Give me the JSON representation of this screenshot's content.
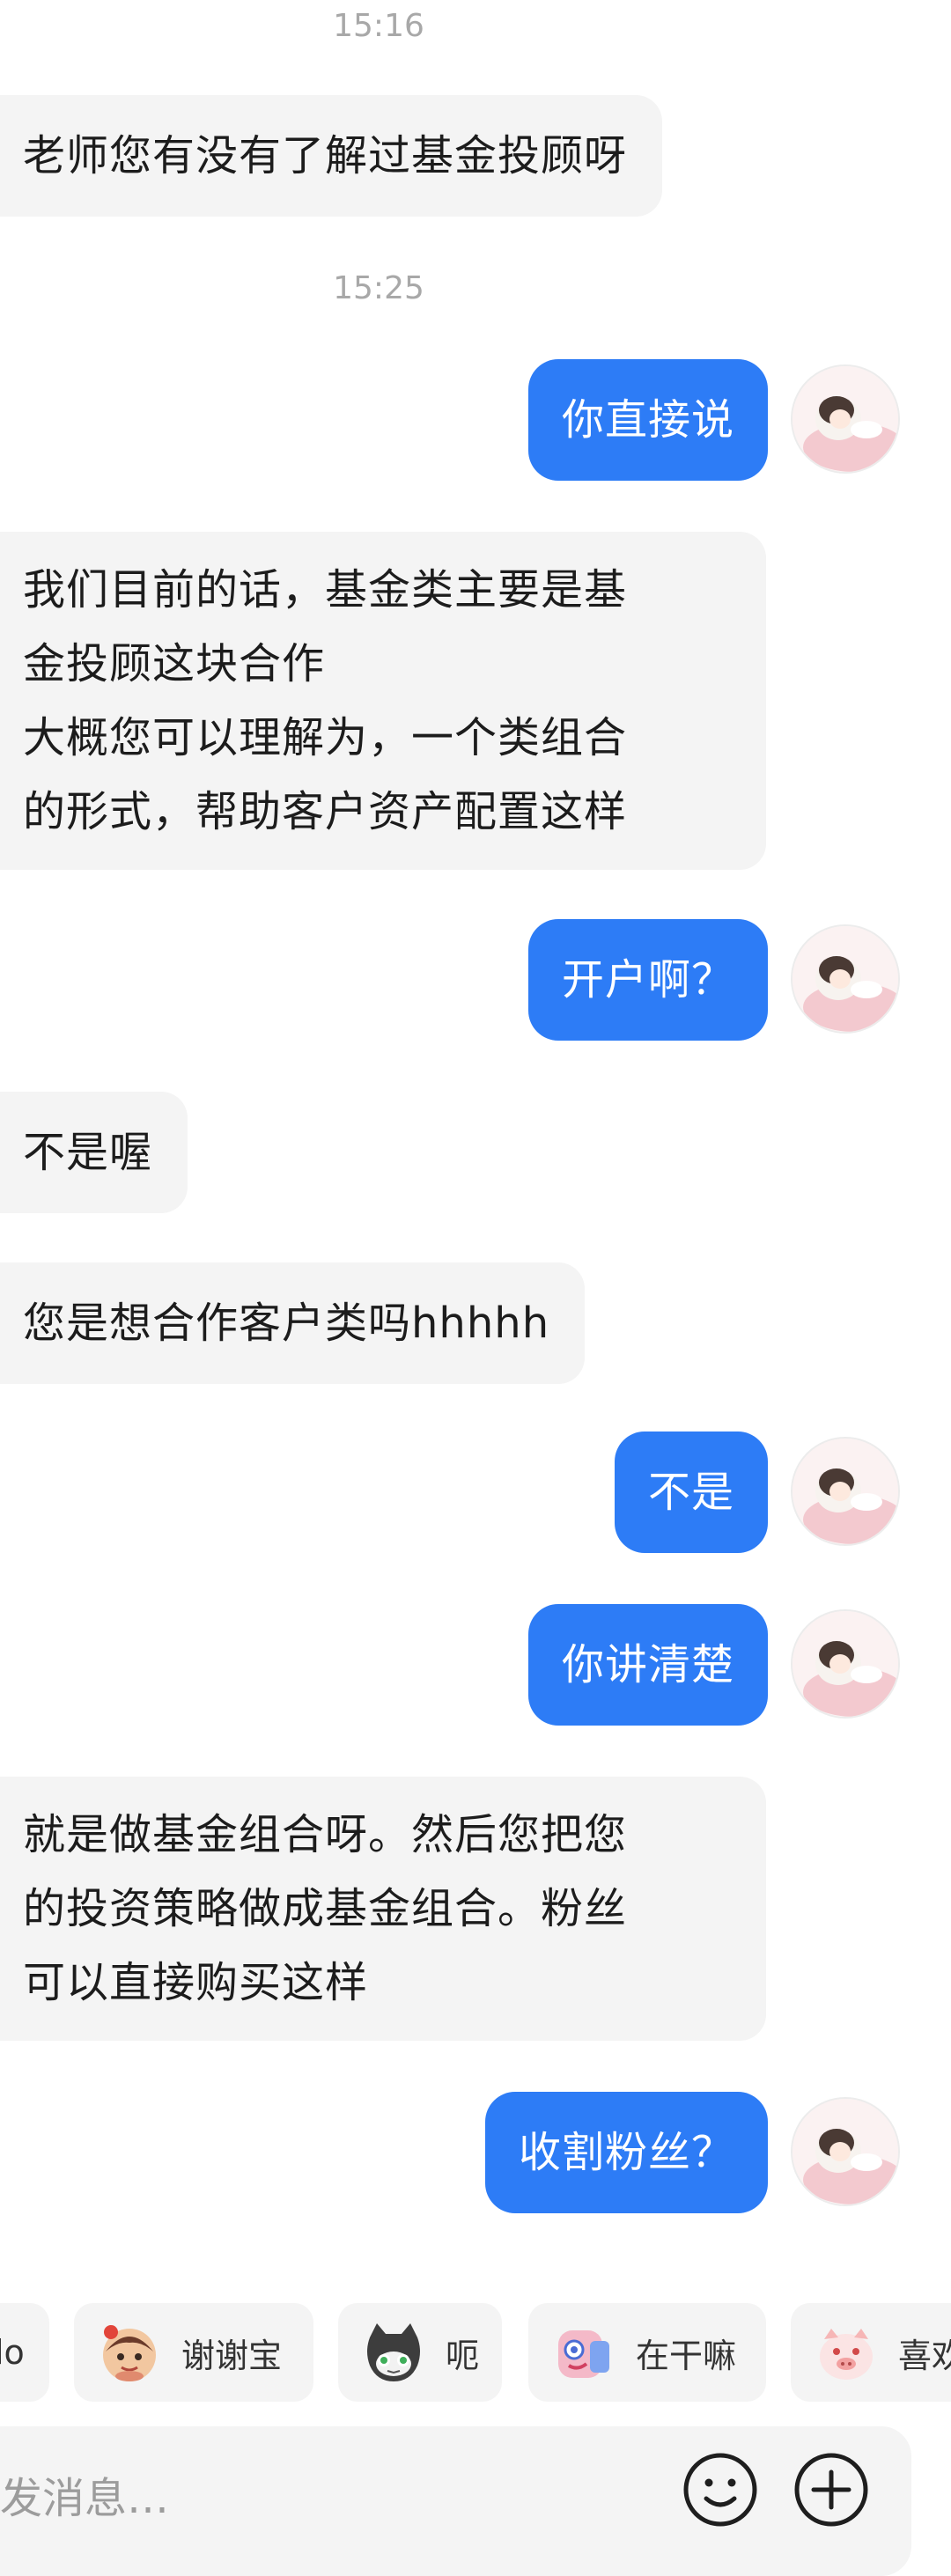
{
  "messages": {
    "t1": "15:16",
    "m1": "老师您有没有了解过基金投顾呀",
    "t2": "15:25",
    "m2": "你直接说",
    "m3": "我们目前的话，基金类主要是基\n金投顾这块合作\n大概您可以理解为，一个类组合\n的形式，帮助客户资产配置这样",
    "m4": "开户啊？",
    "m5": "不是喔",
    "m6": "您是想合作客户类吗hhhhh",
    "m7": "不是",
    "m8": "你讲清楚",
    "m9": "就是做基金组合呀。然后您把您\n的投资策略做成基金组合。粉丝\n可以直接购买这样",
    "m10": "收割粉丝？"
  },
  "quick_replies": [
    {
      "label": "lo",
      "icon": "partial-chip"
    },
    {
      "label": "谢谢宝",
      "icon": "thank-you-emoji-icon"
    },
    {
      "label": "呃",
      "icon": "cat-emoji-icon"
    },
    {
      "label": "在干嘛",
      "icon": "peek-emoji-icon"
    },
    {
      "label": "喜欢",
      "icon": "pig-emoji-icon"
    }
  ],
  "input": {
    "placeholder": "发消息…"
  },
  "icons": {
    "emoji_button": "smiley-icon",
    "plus_button": "plus-circle-icon"
  },
  "colors": {
    "outgoing_bubble": "#2d7cf6",
    "incoming_bubble": "#f4f4f4",
    "timestamp": "#a8a8a8"
  }
}
